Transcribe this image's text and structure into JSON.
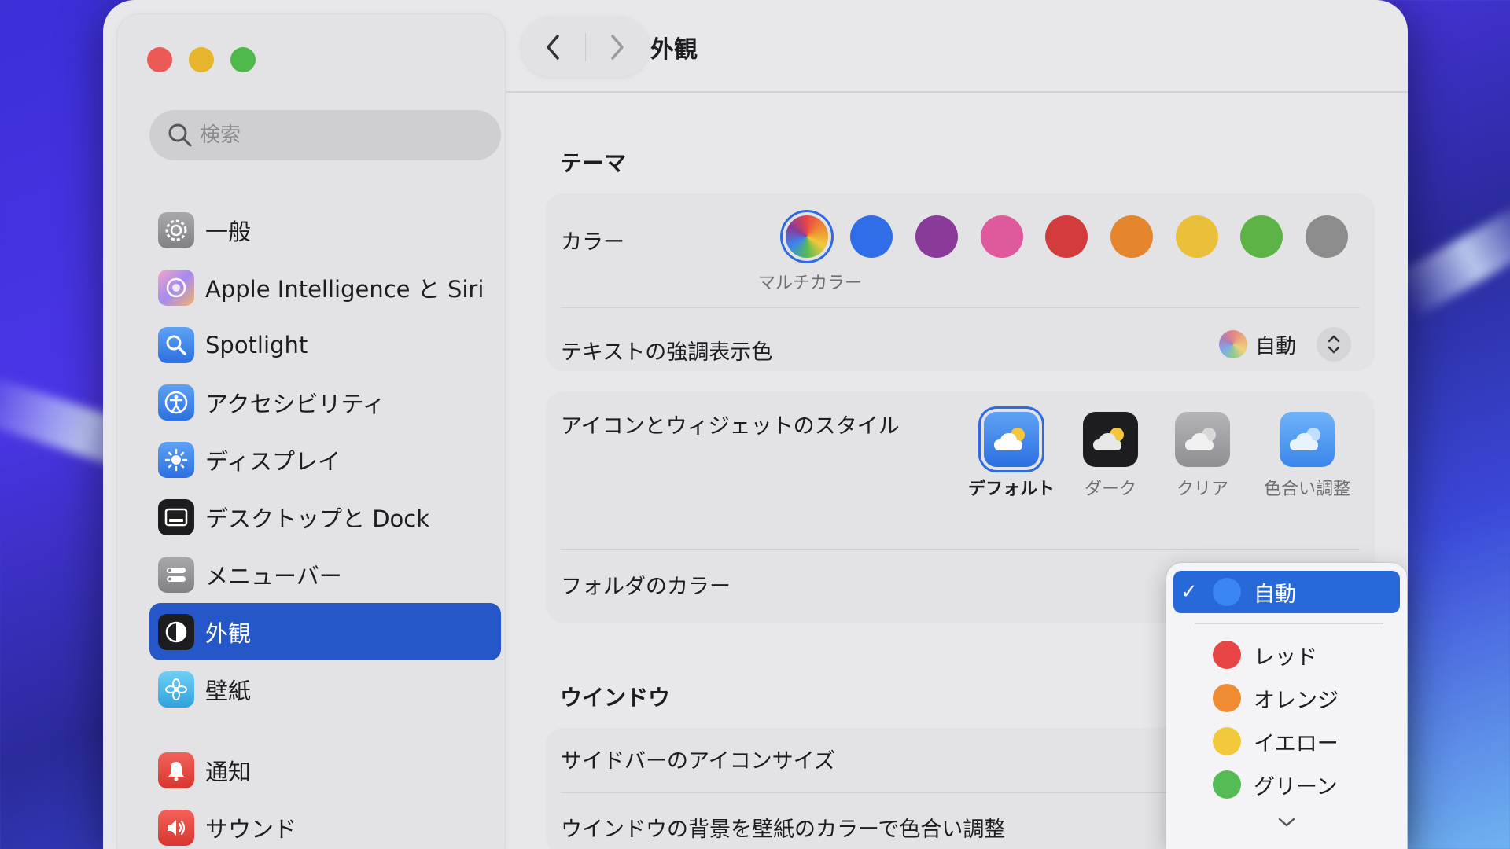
{
  "window": {
    "title": "外観"
  },
  "sidebar": {
    "search_placeholder": "検索",
    "items": [
      {
        "label": "一般",
        "icon": "gear-icon"
      },
      {
        "label": "Apple Intelligence と Siri",
        "icon": "siri-icon"
      },
      {
        "label": "Spotlight",
        "icon": "spotlight-icon"
      },
      {
        "label": "アクセシビリティ",
        "icon": "accessibility-icon"
      },
      {
        "label": "ディスプレイ",
        "icon": "display-icon"
      },
      {
        "label": "デスクトップと Dock",
        "icon": "dock-icon"
      },
      {
        "label": "メニューバー",
        "icon": "menubar-icon"
      },
      {
        "label": "外観",
        "icon": "appearance-icon",
        "selected": true
      },
      {
        "label": "壁紙",
        "icon": "wallpaper-icon"
      },
      {
        "label": "通知",
        "icon": "notifications-icon"
      },
      {
        "label": "サウンド",
        "icon": "sound-icon"
      }
    ]
  },
  "content": {
    "theme_section": "テーマ",
    "color_label": "カラー",
    "colors": [
      {
        "name": "multicolor",
        "hex": "multicolor",
        "selected": true
      },
      {
        "name": "blue",
        "hex": "#2f6ee6"
      },
      {
        "name": "purple",
        "hex": "#8a3b9a"
      },
      {
        "name": "pink",
        "hex": "#de5a9c"
      },
      {
        "name": "red",
        "hex": "#d33c3c"
      },
      {
        "name": "orange",
        "hex": "#e5852e"
      },
      {
        "name": "yellow",
        "hex": "#eabf3a"
      },
      {
        "name": "green",
        "hex": "#5db346"
      },
      {
        "name": "graphite",
        "hex": "#8c8c8c"
      }
    ],
    "selected_color_caption": "マルチカラー",
    "highlight_label": "テキストの強調表示色",
    "highlight_value": "自動",
    "icon_style_label": "アイコンとウィジェットのスタイル",
    "icon_styles": [
      "デフォルト",
      "ダーク",
      "クリア",
      "色合い調整"
    ],
    "folder_color_label": "フォルダのカラー",
    "window_section": "ウインドウ",
    "sidebar_icon_size_label": "サイドバーのアイコンサイズ",
    "tint_background_label": "ウインドウの背景を壁紙のカラーで色合い調整"
  },
  "folder_menu": {
    "items": [
      {
        "label": "自動",
        "color": "#3a86f2",
        "checked": true
      },
      {
        "label": "レッド",
        "color": "#e84545"
      },
      {
        "label": "オレンジ",
        "color": "#ef8c33"
      },
      {
        "label": "イエロー",
        "color": "#f2c93a"
      },
      {
        "label": "グリーン",
        "color": "#55bb55"
      }
    ],
    "check_glyph": "✓"
  }
}
